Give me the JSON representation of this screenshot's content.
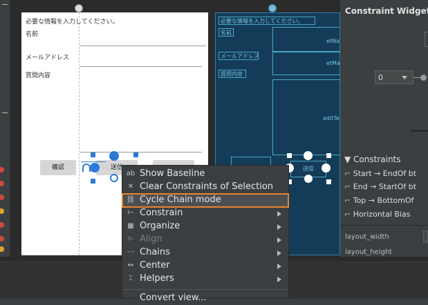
{
  "design_view": {
    "hint": "必要な情報を入力してください。",
    "label_name": "名前",
    "label_email": "メールアドレス",
    "label_question": "質問内容",
    "confirm_button": "確認",
    "send_button": "送信"
  },
  "blueprint_view": {
    "hint": "必要な情報を入力してください。",
    "label_name": "名前",
    "label_email": "メールアドレス",
    "label_question": "質問内容",
    "et_name": "etNa",
    "et_mail": "etMa",
    "edit_text": "editTe",
    "send_button": "送信"
  },
  "attributes_panel": {
    "title": "Constraint Widget",
    "margin_value": "0",
    "constraints_header": "▼ Constraints",
    "constraints": [
      "Start → EndOf bt",
      "End → StartOf bt",
      "Top → BottomOf",
      "Horizontal Bias"
    ],
    "layout_width": "layout_width",
    "layout_height": "layout_height"
  },
  "context_menu": {
    "items": [
      {
        "label": "Show Baseline",
        "icon": "baseline-icon",
        "glyph": "ab",
        "enabled": true,
        "submenu": false
      },
      {
        "label": "Clear Constraints of Selection",
        "icon": "clear-constraints-icon",
        "glyph": "✕",
        "enabled": true,
        "submenu": false
      },
      {
        "label": "Cycle Chain mode",
        "icon": "chain-link-icon",
        "glyph": "⛓",
        "enabled": true,
        "submenu": false
      },
      {
        "label": "Constrain",
        "icon": "constrain-icon",
        "glyph": "⊢",
        "enabled": true,
        "submenu": true
      },
      {
        "label": "Organize",
        "icon": "organize-icon",
        "glyph": "▦",
        "enabled": true,
        "submenu": true
      },
      {
        "label": "Align",
        "icon": "align-icon",
        "glyph": "⊫",
        "enabled": false,
        "submenu": true
      },
      {
        "label": "Chains",
        "icon": "chains-icon",
        "glyph": "⋯",
        "enabled": true,
        "submenu": true
      },
      {
        "label": "Center",
        "icon": "center-icon",
        "glyph": "↔",
        "enabled": true,
        "submenu": true
      },
      {
        "label": "Helpers",
        "icon": "helpers-icon",
        "glyph": "⌶",
        "enabled": true,
        "submenu": true
      },
      {
        "label": "Convert view...",
        "icon": "",
        "glyph": "",
        "enabled": true,
        "submenu": false
      }
    ],
    "selected_index": 2
  },
  "colors": {
    "selection_outline": "#e8862d",
    "handle_blue": "#2b7bd6",
    "blueprint_bg": "#143c58",
    "error_dot": "#d0483b",
    "warning_dot": "#e0a32b"
  }
}
